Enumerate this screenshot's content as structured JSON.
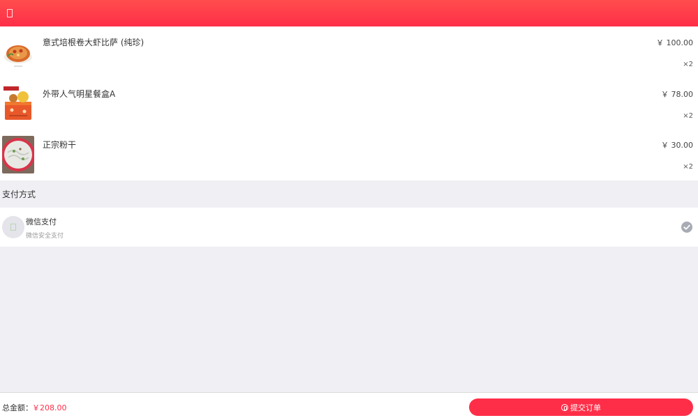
{
  "order_items": [
    {
      "name": "意式培根卷大虾比萨 (纯珍)",
      "price": "￥ 100.00",
      "qty": "×2",
      "thumb_icon": "pizza-thumbnail"
    },
    {
      "name": "外带人气明星餐盒A",
      "price": "￥ 78.00",
      "qty": "×2",
      "thumb_icon": "meal-box-thumbnail"
    },
    {
      "name": "正宗粉干",
      "price": "￥ 30.00",
      "qty": "×2",
      "thumb_icon": "noodle-bowl-thumbnail"
    }
  ],
  "payment": {
    "section_title": "支付方式",
    "method_name": "微信支付",
    "method_desc": "微信安全支付",
    "icon": "wechat-pay-icon",
    "selected": true
  },
  "footer": {
    "total_label": "总金额：",
    "total_value": "￥208.00",
    "submit_label": "提交订单"
  },
  "colors": {
    "brand_red": "#ff2e48",
    "header_top": "#ff4d4d",
    "page_bg": "#f0f0f4"
  }
}
